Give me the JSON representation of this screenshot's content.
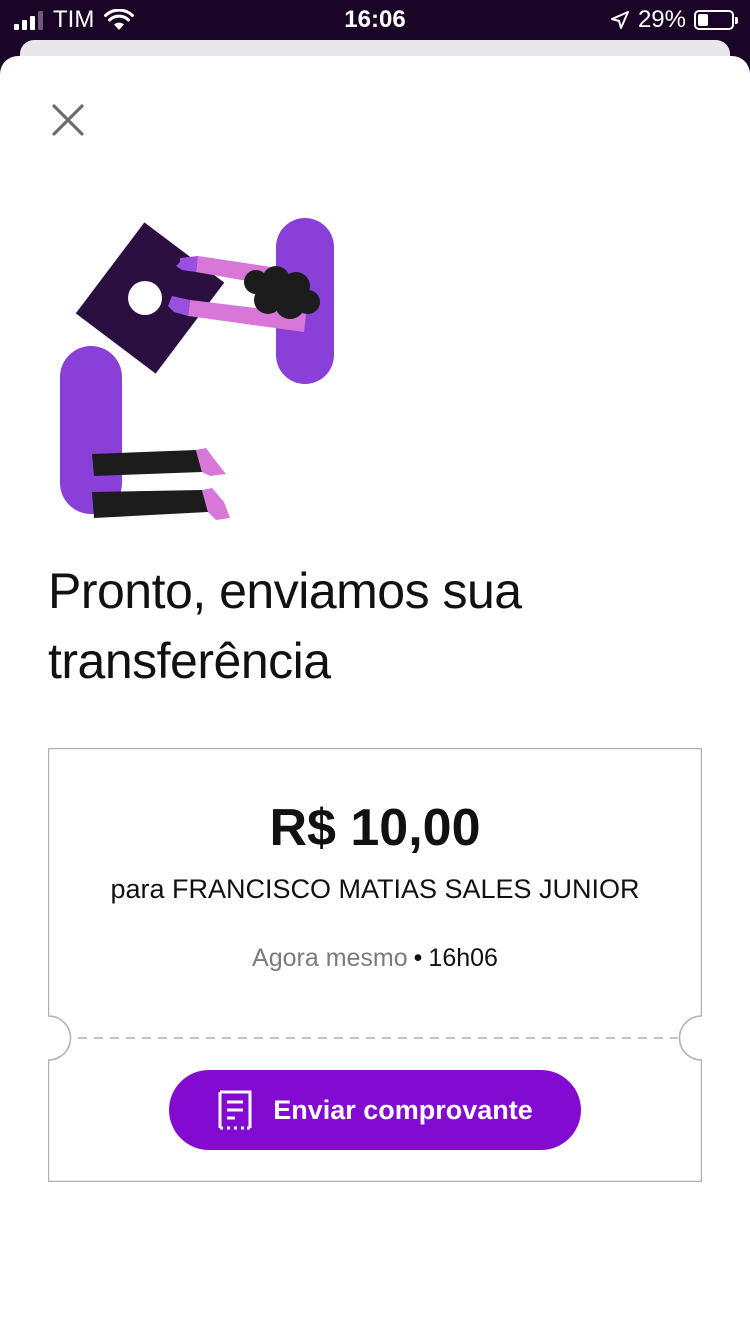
{
  "status_bar": {
    "carrier": "TIM",
    "time": "16:06",
    "battery": "29%",
    "battery_level": 0.29
  },
  "icons": {
    "close": "close-icon",
    "receipt": "receipt-icon",
    "location": "location-arrow-icon",
    "wifi": "wifi-icon"
  },
  "colors": {
    "brand": "#820ad1",
    "status_bar_bg": "#1a0526"
  },
  "title": {
    "line1": "Pronto, enviamos sua",
    "line2": "transferência"
  },
  "receipt": {
    "amount": "R$ 10,00",
    "recipient": "para FRANCISCO MATIAS SALES JUNIOR",
    "when_label": "Agora mesmo",
    "separator": "•",
    "time": "16h06",
    "send_button_label": "Enviar comprovante"
  }
}
